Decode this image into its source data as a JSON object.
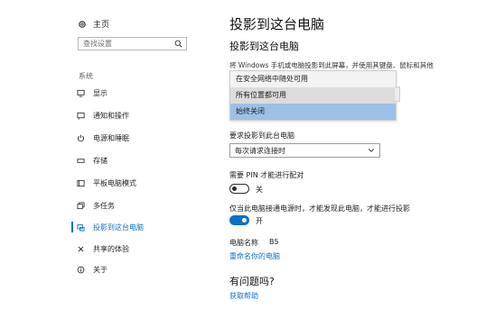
{
  "sidebar": {
    "home_label": "主页",
    "search_placeholder": "查找设置",
    "group_label": "系统",
    "items": [
      {
        "label": "显示",
        "icon": "monitor-icon"
      },
      {
        "label": "通知和操作",
        "icon": "notification-icon"
      },
      {
        "label": "电源和睡眠",
        "icon": "power-icon"
      },
      {
        "label": "存储",
        "icon": "storage-icon"
      },
      {
        "label": "平板电脑模式",
        "icon": "tablet-icon"
      },
      {
        "label": "多任务",
        "icon": "multitask-icon"
      },
      {
        "label": "投影到这台电脑",
        "icon": "project-icon",
        "active": true
      },
      {
        "label": "共享的体验",
        "icon": "share-icon"
      },
      {
        "label": "关于",
        "icon": "info-icon"
      }
    ]
  },
  "main": {
    "page_title": "投影到这台电脑",
    "section_title": "投影到这台电脑",
    "description": "将 Windows 手机或电脑投影到此屏幕，并使用其键盘、鼠标和其他",
    "availability_dropdown": {
      "options": [
        "在安全网络中随处可用",
        "所有位置都可用",
        "始终关闭"
      ],
      "hovered_index": 1,
      "selected_index": 2
    },
    "request_label": "要求投影到此台电脑",
    "request_select_value": "每次请求连接时",
    "pin_label": "需要 PIN 才能进行配对",
    "pin_toggle_state": "关",
    "power_label": "仅当此电脑接通电源时，才能发现此电脑，才能进行投影",
    "power_toggle_state": "开",
    "pc_name_label": "电脑名称",
    "pc_name_value": "B5",
    "rename_link": "重命名你的电脑",
    "question_title": "有问题吗?",
    "help_link": "获取帮助"
  },
  "colors": {
    "accent": "#0f6fc6",
    "selected_option": "#9cc0e6",
    "hover_option": "#dcdcdc"
  }
}
